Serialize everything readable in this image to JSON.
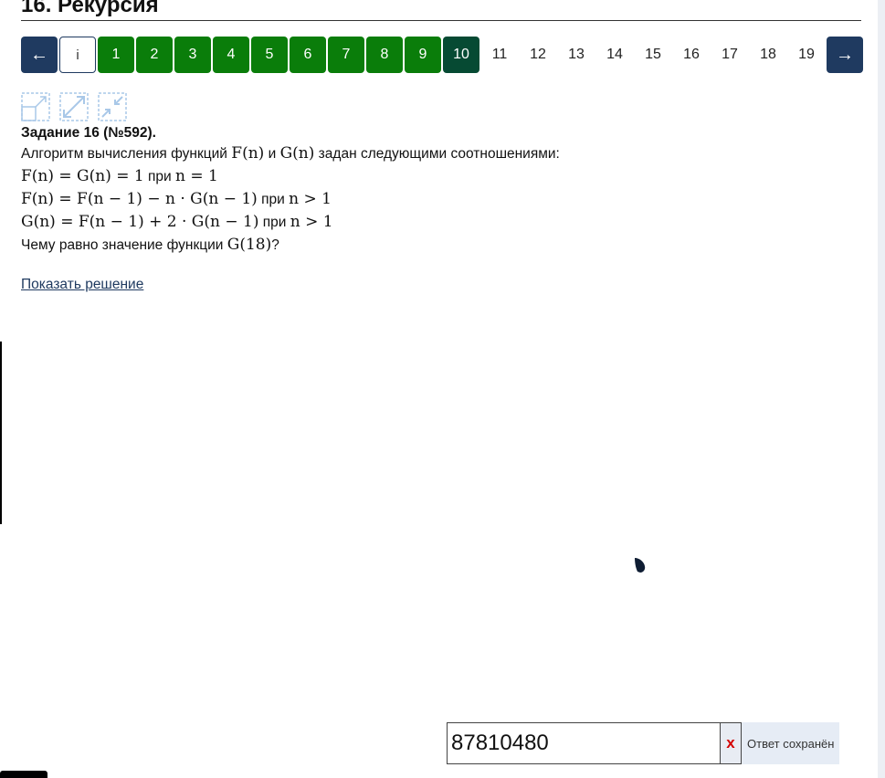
{
  "page": {
    "title": "16. Рекурсия"
  },
  "pager": {
    "prev": "←",
    "info": "i",
    "done": [
      "1",
      "2",
      "3",
      "4",
      "5",
      "6",
      "7",
      "8",
      "9"
    ],
    "current": "10",
    "pending": [
      "11",
      "12",
      "13",
      "14",
      "15",
      "16",
      "17",
      "18",
      "19"
    ],
    "next": "→"
  },
  "view_buttons": {
    "icons": [
      "fullscreen-split-icon",
      "expand-icon",
      "collapse-icon"
    ],
    "accent": "#a9c8e8"
  },
  "task": {
    "header": "Задание 16 (№592).",
    "intro_before": "Алгоритм вычисления функций ",
    "f_n": "F(n)",
    "and": " и ",
    "g_n": "G(n)",
    "intro_after": " задан следующими соотношениями:",
    "rule1_expr": "F(n) = G(n) = 1",
    "rule1_cond_word": " при ",
    "rule1_cond": "n = 1",
    "rule2_expr": "F(n) = F(n − 1) − n · G(n − 1)",
    "rule2_cond_word": " при ",
    "rule2_cond": "n > 1",
    "rule3_expr": "G(n) = F(n − 1) + 2 · G(n − 1)",
    "rule3_cond_word": " при ",
    "rule3_cond": "n > 1",
    "question_before": "Чему равно значение функции ",
    "question_expr": "G(18)",
    "question_after": "?",
    "show_solution": "Показать решение"
  },
  "answer": {
    "value": "87810480",
    "clear": "x",
    "status": "Ответ сохранён"
  },
  "colors": {
    "nav": "#1f3a60",
    "done": "#0a7d0a",
    "current": "#064a33",
    "clear": "#d40000"
  }
}
